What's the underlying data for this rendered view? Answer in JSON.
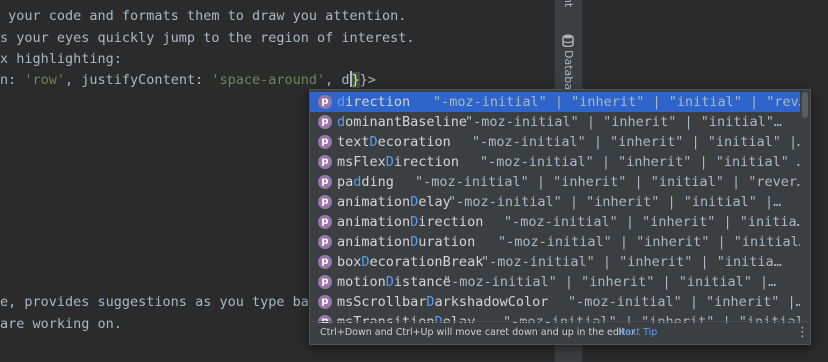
{
  "editor": {
    "lines": [
      " your code and formats them to draw you attention.",
      "s your eyes quickly jump to the region of interest.",
      "x highlighting:"
    ],
    "code_line": {
      "prefix": "n: ",
      "str1": "'row'",
      "mid": ", justifyContent: ",
      "str2": "'space-around'",
      "tail": ", d",
      "brace": "}",
      "after": "}>"
    },
    "bottom_lines": [
      "e, provides suggestions as you type bas",
      "are working on."
    ]
  },
  "side_panel": {
    "tab_partial": "nt",
    "database_label": "Database"
  },
  "completion": {
    "items": [
      {
        "match": "d",
        "rest": "irection",
        "type": "\"-moz-initial\" | \"inherit\" | \"initial\" | \"rev…"
      },
      {
        "match": "d",
        "rest": "ominantBaseline",
        "type": "\"-moz-initial\" | \"inherit\" | \"initial\"…"
      },
      {
        "pre": "text",
        "match": "D",
        "rest": "ecoration",
        "type": "\"-moz-initial\" | \"inherit\" | \"initial\" |…"
      },
      {
        "pre": "msFlex",
        "match": "D",
        "rest": "irection",
        "type": "\"-moz-initial\" | \"inherit\" | \"initial\" …"
      },
      {
        "pre": "pa",
        "match": "d",
        "rest": "ding",
        "type": "\"-moz-initial\" | \"inherit\" | \"initial\" | \"rever…"
      },
      {
        "pre": "animation",
        "match": "D",
        "rest": "elay",
        "type": "\"-moz-initial\" | \"inherit\" | \"initial\" |…"
      },
      {
        "pre": "animation",
        "match": "D",
        "rest": "irection",
        "type": "\"-moz-initial\" | \"inherit\" | \"initia…"
      },
      {
        "pre": "animation",
        "match": "D",
        "rest": "uration",
        "type": "\"-moz-initial\" | \"inherit\" | \"initial…"
      },
      {
        "pre": "box",
        "match": "D",
        "rest": "ecorationBreak",
        "type": "\"-moz-initial\" | \"inherit\" | \"initia…"
      },
      {
        "pre": "motion",
        "match": "D",
        "rest": "istance",
        "type": "\"-moz-initial\" | \"inherit\" | \"initial\" |…"
      },
      {
        "pre": "msScrollbar",
        "match": "D",
        "rest": "arkshadowColor",
        "type": "\"-moz-initial\" | \"inherit\" |…"
      },
      {
        "pre": "msTransition",
        "match": "D",
        "rest": "elay",
        "type": "\"-moz-initial\" | \"inherit\" | \"initial…"
      }
    ],
    "type_offsets_px": null,
    "footer_hint": "Ctrl+Down and Ctrl+Up will move caret down and up in the editor",
    "footer_link": "Next Tip",
    "more_icon": "more-vertical-icon"
  },
  "colors": {
    "selection": "#2f65ca",
    "match": "#589df6",
    "property_badge": "#9876aa",
    "string": "#6a8759"
  }
}
